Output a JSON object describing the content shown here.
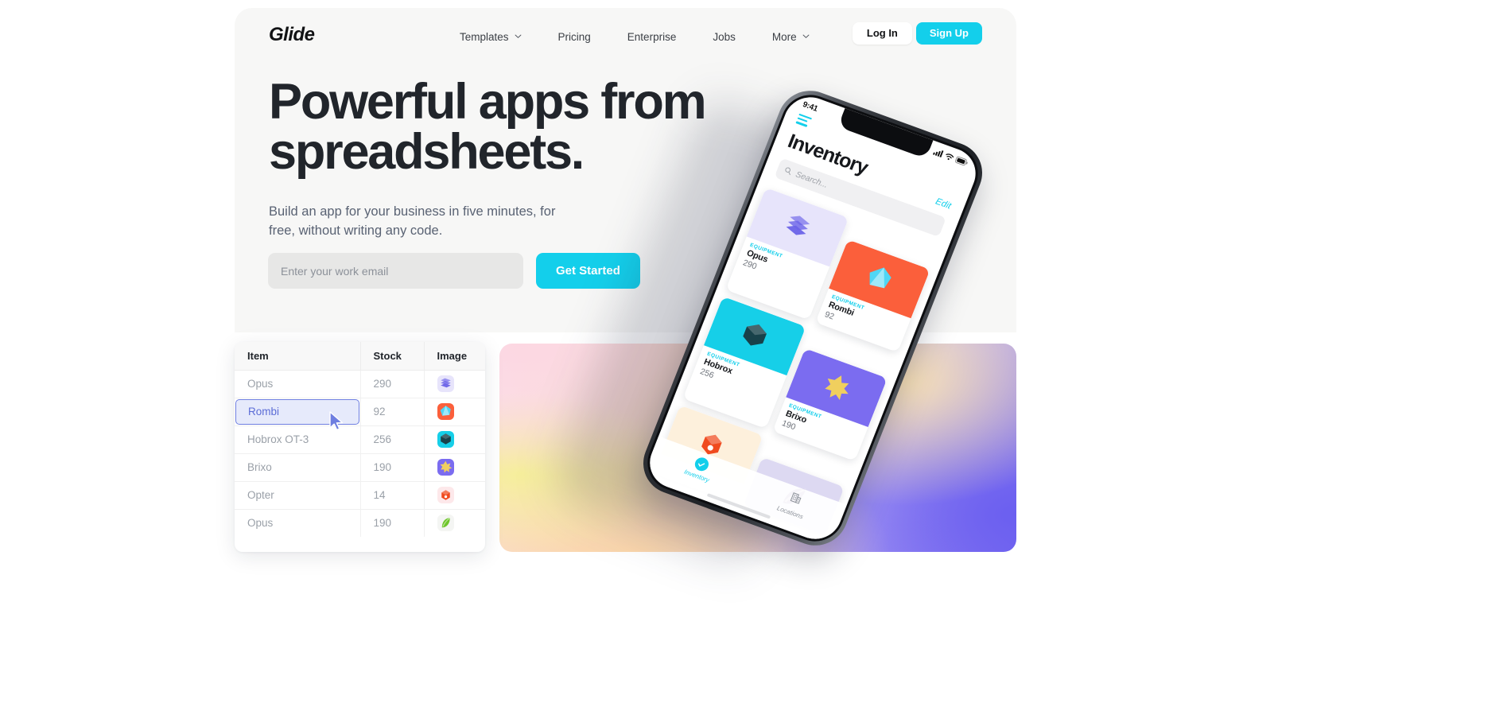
{
  "brand": {
    "logo": "Glide",
    "accent": "#13cfeb",
    "text_dark": "#21252b"
  },
  "nav": {
    "items": [
      {
        "label": "Templates",
        "has_chevron": true,
        "icon": "chevron-down-icon"
      },
      {
        "label": "Pricing",
        "has_chevron": false,
        "icon": ""
      },
      {
        "label": "Enterprise",
        "has_chevron": false,
        "icon": ""
      },
      {
        "label": "Jobs",
        "has_chevron": false,
        "icon": ""
      },
      {
        "label": "More",
        "has_chevron": true,
        "icon": "chevron-down-icon"
      }
    ],
    "login_label": "Log In",
    "signup_label": "Sign Up"
  },
  "hero": {
    "headline": "Powerful apps from spreadsheets.",
    "subhead": "Build an app for your business in five minutes, for free, without writing any code.",
    "email_placeholder": "Enter your work email",
    "email_value": "",
    "cta_label": "Get Started"
  },
  "spreadsheet": {
    "columns": [
      "Item",
      "Stock",
      "Image"
    ],
    "selected_row_index": 1,
    "rows": [
      {
        "item": "Opus",
        "stock": "290",
        "icon": "stack-icon",
        "bg": "#e7e4fb",
        "shape": "#6b63e8"
      },
      {
        "item": "Rombi",
        "stock": "92",
        "icon": "crystal-icon",
        "bg": "#fb5f3b",
        "shape": "#4fd6f5"
      },
      {
        "item": "Hobrox OT-3",
        "stock": "256",
        "icon": "gem-icon",
        "bg": "#16cfe8",
        "shape": "#18414a"
      },
      {
        "item": "Brixo",
        "stock": "190",
        "icon": "star-icon",
        "bg": "#7b6cf0",
        "shape": "#f0cf5e"
      },
      {
        "item": "Opter",
        "stock": "14",
        "icon": "cube-icon",
        "bg": "#fde8ea",
        "shape": "#f04a1e"
      },
      {
        "item": "Opus",
        "stock": "190",
        "icon": "leaf-icon",
        "bg": "#f4f5f3",
        "shape": "#6fc62c"
      }
    ]
  },
  "phone": {
    "status_time": "9:41",
    "app_title": "Inventory",
    "edit_label": "Edit",
    "search_placeholder": "Search...",
    "card_kicker": "EQUIPMENT",
    "cards": [
      {
        "title": "Opus",
        "sub": "290",
        "bg": "#e7e4fb",
        "shape": "#6b63e8"
      },
      {
        "title": "Rombi",
        "sub": "92",
        "bg": "#fb5f3b",
        "shape": "#4fd6f5"
      },
      {
        "title": "Hobrox",
        "sub": "256",
        "bg": "#16cfe8",
        "shape": "#18414a"
      },
      {
        "title": "Brixo",
        "sub": "190",
        "bg": "#7b6cf0",
        "shape": "#f0cf5e"
      },
      {
        "title": "",
        "sub": "",
        "bg": "#fdf0dc",
        "shape": "#f04a1e"
      },
      {
        "title": "",
        "sub": "",
        "bg": "#ddd9f2",
        "shape": "#7d5fa8"
      }
    ],
    "tabs": [
      {
        "label": "Inventory",
        "active": true,
        "icon": "check-circle-icon"
      },
      {
        "label": "Locations",
        "active": false,
        "icon": "building-icon"
      }
    ]
  }
}
